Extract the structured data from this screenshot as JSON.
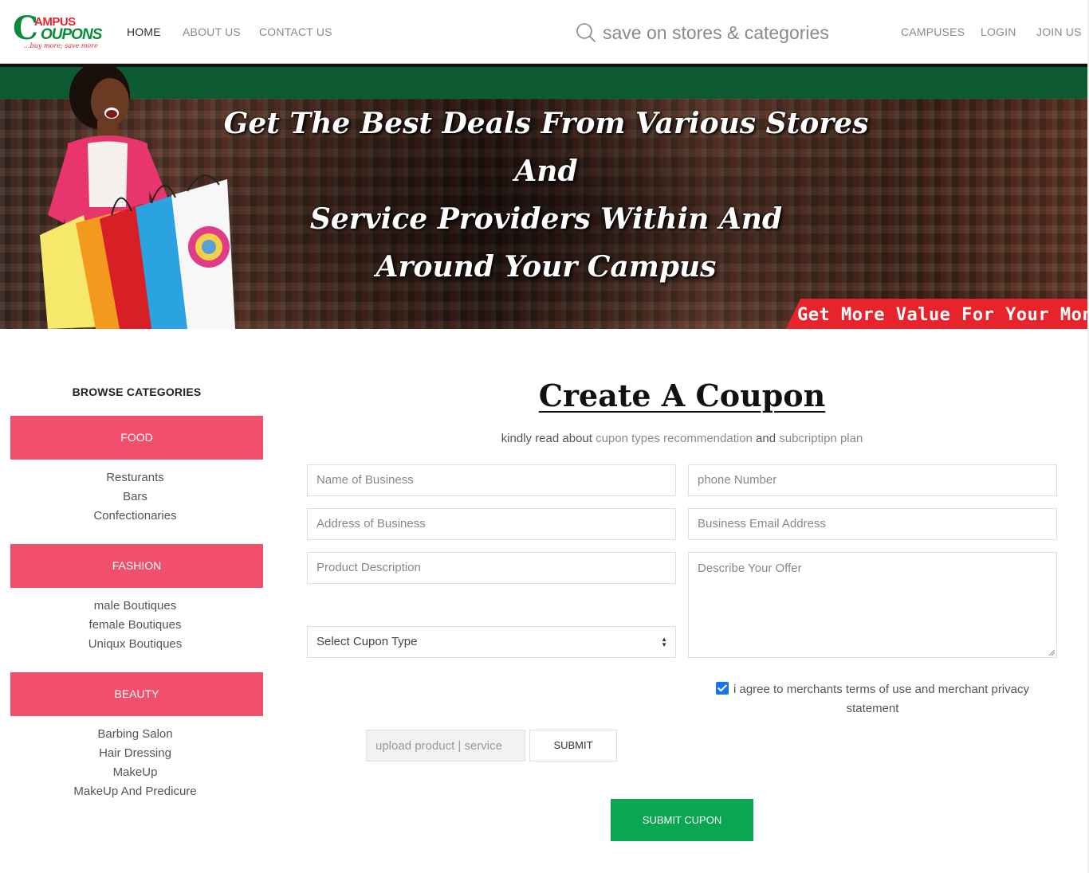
{
  "header": {
    "logo": {
      "top": "AMPUS",
      "bottom": "OUPONS",
      "letter": "C",
      "tagline": "...buy more; save more"
    },
    "nav_left": [
      "HOME",
      "ABOUT US",
      "CONTACT US"
    ],
    "search_placeholder": "save on stores & categories",
    "nav_right": [
      "CAMPUSES",
      "LOGIN",
      "JOIN US"
    ]
  },
  "banner": {
    "headline_lines": [
      "Get The Best Deals From Various Stores And",
      "Service Providers Within And",
      "Around Your Campus"
    ],
    "tagline": "Get More Value For Your Money"
  },
  "sidebar": {
    "title": "BROWSE CATEGORIES",
    "categories": [
      {
        "label": "FOOD",
        "items": [
          "Resturants",
          "Bars",
          "Confectionaries"
        ]
      },
      {
        "label": "FASHION",
        "items": [
          "male Boutiques",
          "female Boutiques",
          "Uniqux Boutiques"
        ]
      },
      {
        "label": "BEAUTY",
        "items": [
          "Barbing Salon",
          "Hair Dressing",
          "MakeUp",
          "MakeUp And Predicure"
        ]
      }
    ]
  },
  "form": {
    "title": "Create A Coupon",
    "subtitle_pre": "kindly read about ",
    "link1": "cupon types recommendation",
    "subtitle_mid": " and ",
    "link2": "subcriptipn plan",
    "fields": {
      "name": "Name of Business",
      "phone": "phone Number",
      "address": "Address of Business",
      "email": "Business Email Address",
      "product": "Product Description",
      "offer": "Describe Your Offer",
      "coupon_type": "Select Cupon Type"
    },
    "agree_text": "i agree to merchants terms of use and merchant privacy statement",
    "agree_checked": true,
    "upload_label": "upload product | service",
    "submit_label": "SUBMIT",
    "submit_coupon_label": "SUBMIT CUPON"
  },
  "colors": {
    "category_pink": "#f1506c",
    "submit_green": "#0aa653",
    "banner_green": "#0e5a32",
    "banner_red": "#e8232b"
  }
}
